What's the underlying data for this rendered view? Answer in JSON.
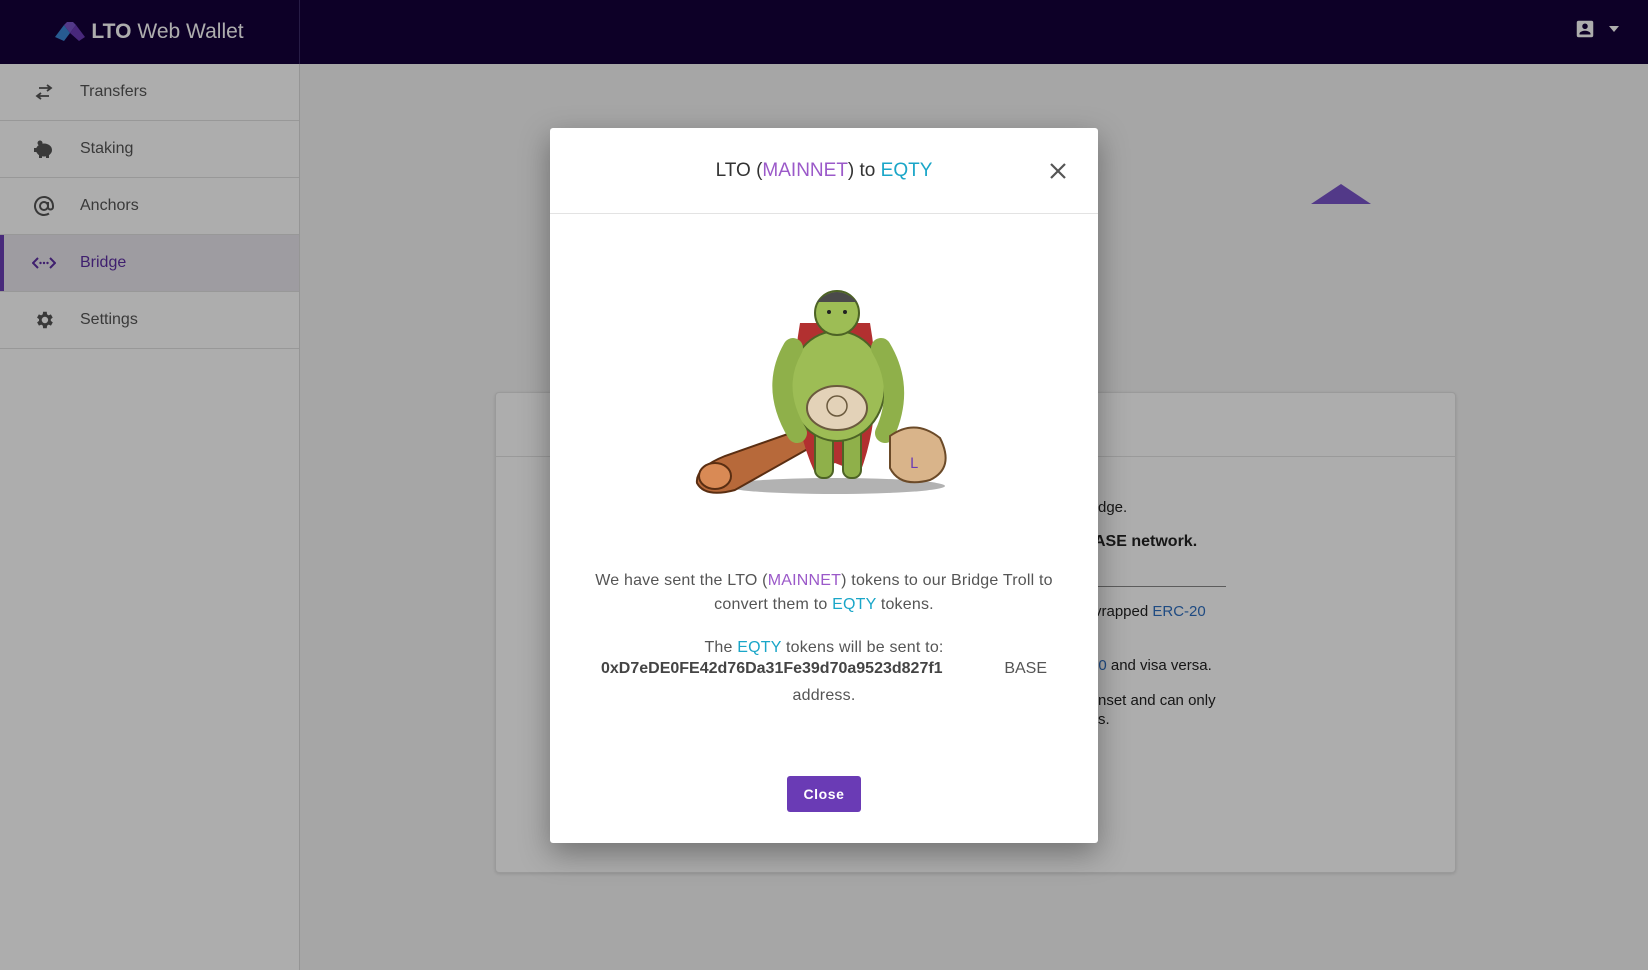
{
  "app": {
    "brand_lto": "LTO",
    "brand_rest": "Web Wallet"
  },
  "sidebar": {
    "items": [
      {
        "label": "Transfers",
        "icon": "swap-arrows-icon",
        "active": false
      },
      {
        "label": "Staking",
        "icon": "piggy-bank-icon",
        "active": false
      },
      {
        "label": "Anchors",
        "icon": "at-sign-icon",
        "active": false
      },
      {
        "label": "Bridge",
        "icon": "code-arrows-icon",
        "active": true
      },
      {
        "label": "Settings",
        "icon": "gear-icon",
        "active": false
      }
    ]
  },
  "background_card": {
    "lines": [
      "dge.",
      "ASE network.",
      "vrapped",
      "ERC-20",
      "20",
      "and visa versa.",
      "nset and can only",
      "s."
    ]
  },
  "modal": {
    "title": {
      "prefix": "LTO (",
      "network": "MAINNET",
      "middle": ") to ",
      "target": "EQTY"
    },
    "message1": {
      "part1": "We have sent the LTO (",
      "network": "MAINNET",
      "part2": ") tokens to our Bridge Troll to convert them to ",
      "target": "EQTY",
      "part3": " tokens."
    },
    "message2": {
      "part1": "The ",
      "target": "EQTY",
      "part2": " tokens will be sent to:"
    },
    "address": "0xD7eDE0FE42d76Da31Fe39d70a9523d827f1",
    "address_network": "BASE",
    "address_suffix": "address.",
    "close_label": "Close"
  },
  "colors": {
    "topbar": "#14003a",
    "accent_purple": "#6a3bb5",
    "network_purple": "#9b59c9",
    "target_teal": "#1aa6c8"
  }
}
